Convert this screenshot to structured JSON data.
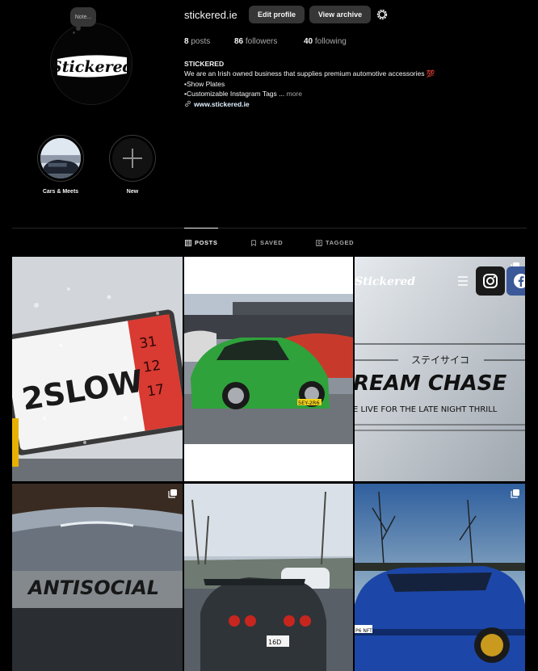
{
  "profile": {
    "note": "Note...",
    "username": "stickered.ie",
    "avatar_logo_text": "Stickered",
    "edit_profile_label": "Edit profile",
    "view_archive_label": "View archive",
    "settings_icon": "gear-icon"
  },
  "stats": {
    "posts_count": "8",
    "posts_label": "posts",
    "followers_count": "86",
    "followers_label": "followers",
    "following_count": "40",
    "following_label": "following"
  },
  "bio": {
    "name": "STICKERED",
    "line1": "We are an Irish owned business that supplies premium automotive accessories",
    "emoji": "💯",
    "line2": "•Show Plates",
    "line3": "•Customizable Instagram Tags ...",
    "more": "more",
    "link": "www.stickered.ie"
  },
  "highlights": [
    {
      "label": "Cars & Meets"
    },
    {
      "label": "New"
    }
  ],
  "tabs": [
    {
      "label": "POSTS",
      "icon": "grid-icon",
      "active": true
    },
    {
      "label": "SAVED",
      "icon": "bookmark-icon",
      "active": false
    },
    {
      "label": "TAGGED",
      "icon": "tagged-icon",
      "active": false
    }
  ],
  "posts": {
    "plate_text": "2SLOW",
    "plate_numbers": [
      "31",
      "12",
      "17"
    ],
    "porsche_plate": "5EY-2R6",
    "banner_logo": "Stickered",
    "banner_jp": "ステイサイコ",
    "banner_title": "REAM CHASE",
    "banner_sub": "E LIVE FOR THE LATE NIGHT THRILL",
    "antisocial_text": "ANTISOCIAL",
    "gtr_plate": "16D",
    "subaru_plate": "P6 NFT"
  },
  "colors": {
    "background": "#000000",
    "button_bg": "#363636",
    "text_primary": "#f5f5f5",
    "text_secondary": "#a8a8a8",
    "link": "#e0f1ff"
  }
}
